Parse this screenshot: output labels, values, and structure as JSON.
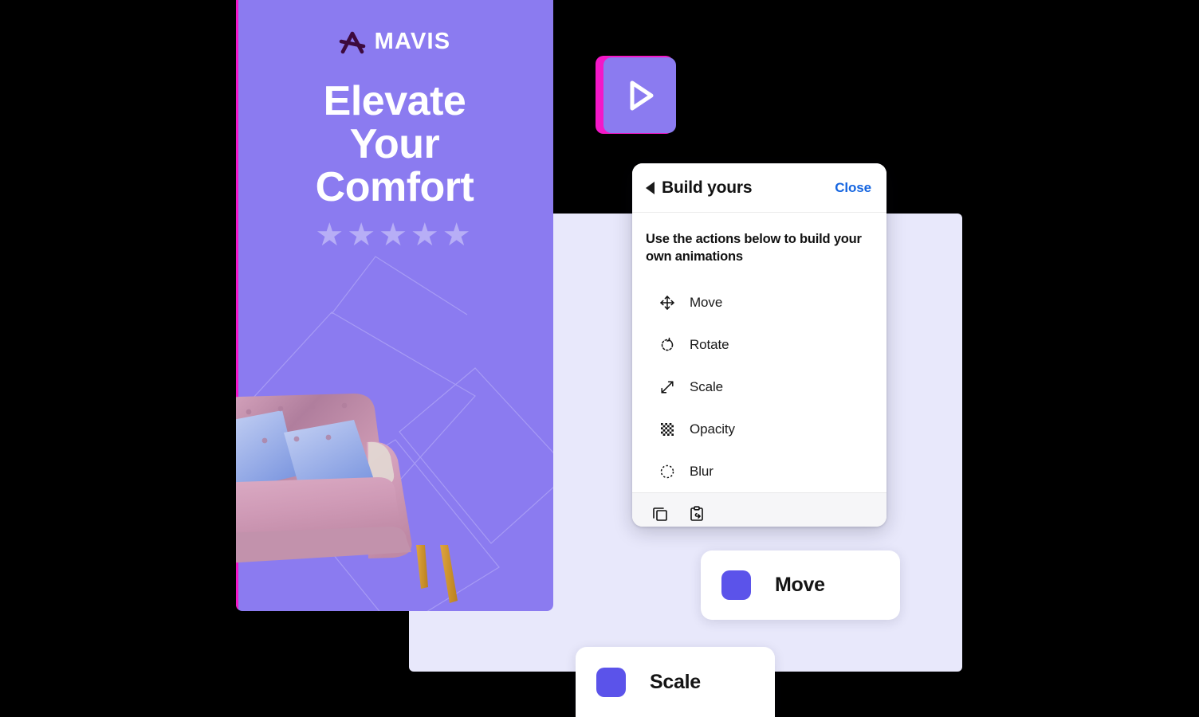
{
  "colors": {
    "poster_bg": "#8b7bf0",
    "backdrop_panel": "#e8e8fb",
    "accent_pink": "#f318c8",
    "swatch_purple": "#5b53ea",
    "close_blue": "#1565e0",
    "star": "#b7aef6",
    "toolbar_bg": "#f6f6f8"
  },
  "poster": {
    "brand_mark_icon": "mavis-a-logomark",
    "brand_name": "MAVIS",
    "headline_lines": [
      "Elevate",
      "Your",
      "Comfort"
    ],
    "rating_stars": "★★★★★",
    "rating_count": 5,
    "product_image_icon": "pink-velvet-sofa-with-blue-pillows"
  },
  "play_button": {
    "icon": "play-triangle-icon"
  },
  "build_panel": {
    "back_icon": "back-triangle-icon",
    "title": "Build yours",
    "close_label": "Close",
    "description": "Use the actions below to build your own animations",
    "actions": [
      {
        "label": "Move",
        "icon": "move-arrows-icon"
      },
      {
        "label": "Rotate",
        "icon": "rotate-arrow-icon"
      },
      {
        "label": "Scale",
        "icon": "scale-diagonal-arrows-icon"
      },
      {
        "label": "Opacity",
        "icon": "checkerboard-icon"
      },
      {
        "label": "Blur",
        "icon": "dashed-circle-icon"
      }
    ],
    "toolbar": [
      {
        "icon": "copy-icon"
      },
      {
        "icon": "paste-icon"
      }
    ]
  },
  "action_cards": [
    {
      "label": "Move",
      "swatch": "#5b53ea"
    },
    {
      "label": "Scale",
      "swatch": "#5b53ea"
    }
  ]
}
